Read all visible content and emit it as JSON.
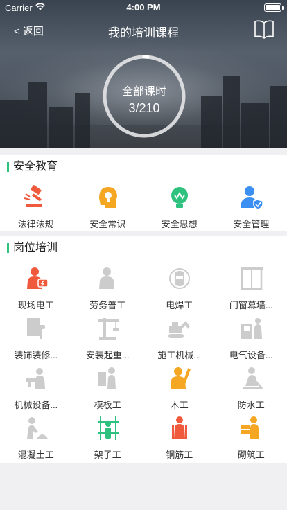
{
  "status_bar": {
    "carrier": "Carrier",
    "time": "4:00 PM"
  },
  "nav": {
    "back_label": "< 返回",
    "title": "我的培训课程",
    "book_icon": "book-icon"
  },
  "progress": {
    "label": "全部课时",
    "value_text": "3/210",
    "completed": 3,
    "total": 210
  },
  "safety": {
    "title": "安全教育",
    "items": [
      {
        "label": "法律法规",
        "icon": "gavel-icon",
        "color": "#f05a3c"
      },
      {
        "label": "安全常识",
        "icon": "lightbulb-head-icon",
        "color": "#f5a623"
      },
      {
        "label": "安全思想",
        "icon": "lightbulb-idea-icon",
        "color": "#2ec27e"
      },
      {
        "label": "安全管理",
        "icon": "user-shield-icon",
        "color": "#3b8ff0"
      }
    ]
  },
  "jobs": {
    "title": "岗位培训",
    "items": [
      {
        "label": "现场电工",
        "icon": "electrician-icon",
        "color": "#f05a3c"
      },
      {
        "label": "劳务普工",
        "icon": "worker-icon",
        "color": "#cccccc"
      },
      {
        "label": "电焊工",
        "icon": "welder-mask-icon",
        "color": "#cccccc"
      },
      {
        "label": "门窗幕墙...",
        "icon": "window-frame-icon",
        "color": "#cccccc"
      },
      {
        "label": "装饰装修...",
        "icon": "paint-roller-icon",
        "color": "#cccccc"
      },
      {
        "label": "安装起重...",
        "icon": "crane-icon",
        "color": "#cccccc"
      },
      {
        "label": "施工机械...",
        "icon": "excavator-icon",
        "color": "#cccccc"
      },
      {
        "label": "电气设备...",
        "icon": "electrical-cabinet-icon",
        "color": "#cccccc"
      },
      {
        "label": "机械设备...",
        "icon": "drill-worker-icon",
        "color": "#cccccc"
      },
      {
        "label": "模板工",
        "icon": "formwork-worker-icon",
        "color": "#cccccc"
      },
      {
        "label": "木工",
        "icon": "carpenter-icon",
        "color": "#f5a623"
      },
      {
        "label": "防水工",
        "icon": "waterproof-worker-icon",
        "color": "#cccccc"
      },
      {
        "label": "混凝土工",
        "icon": "concrete-worker-icon",
        "color": "#cccccc"
      },
      {
        "label": "架子工",
        "icon": "scaffolder-icon",
        "color": "#2ec27e"
      },
      {
        "label": "钢筋工",
        "icon": "rebar-worker-icon",
        "color": "#f05a3c"
      },
      {
        "label": "砌筑工",
        "icon": "bricklayer-icon",
        "color": "#f5a623"
      }
    ]
  }
}
